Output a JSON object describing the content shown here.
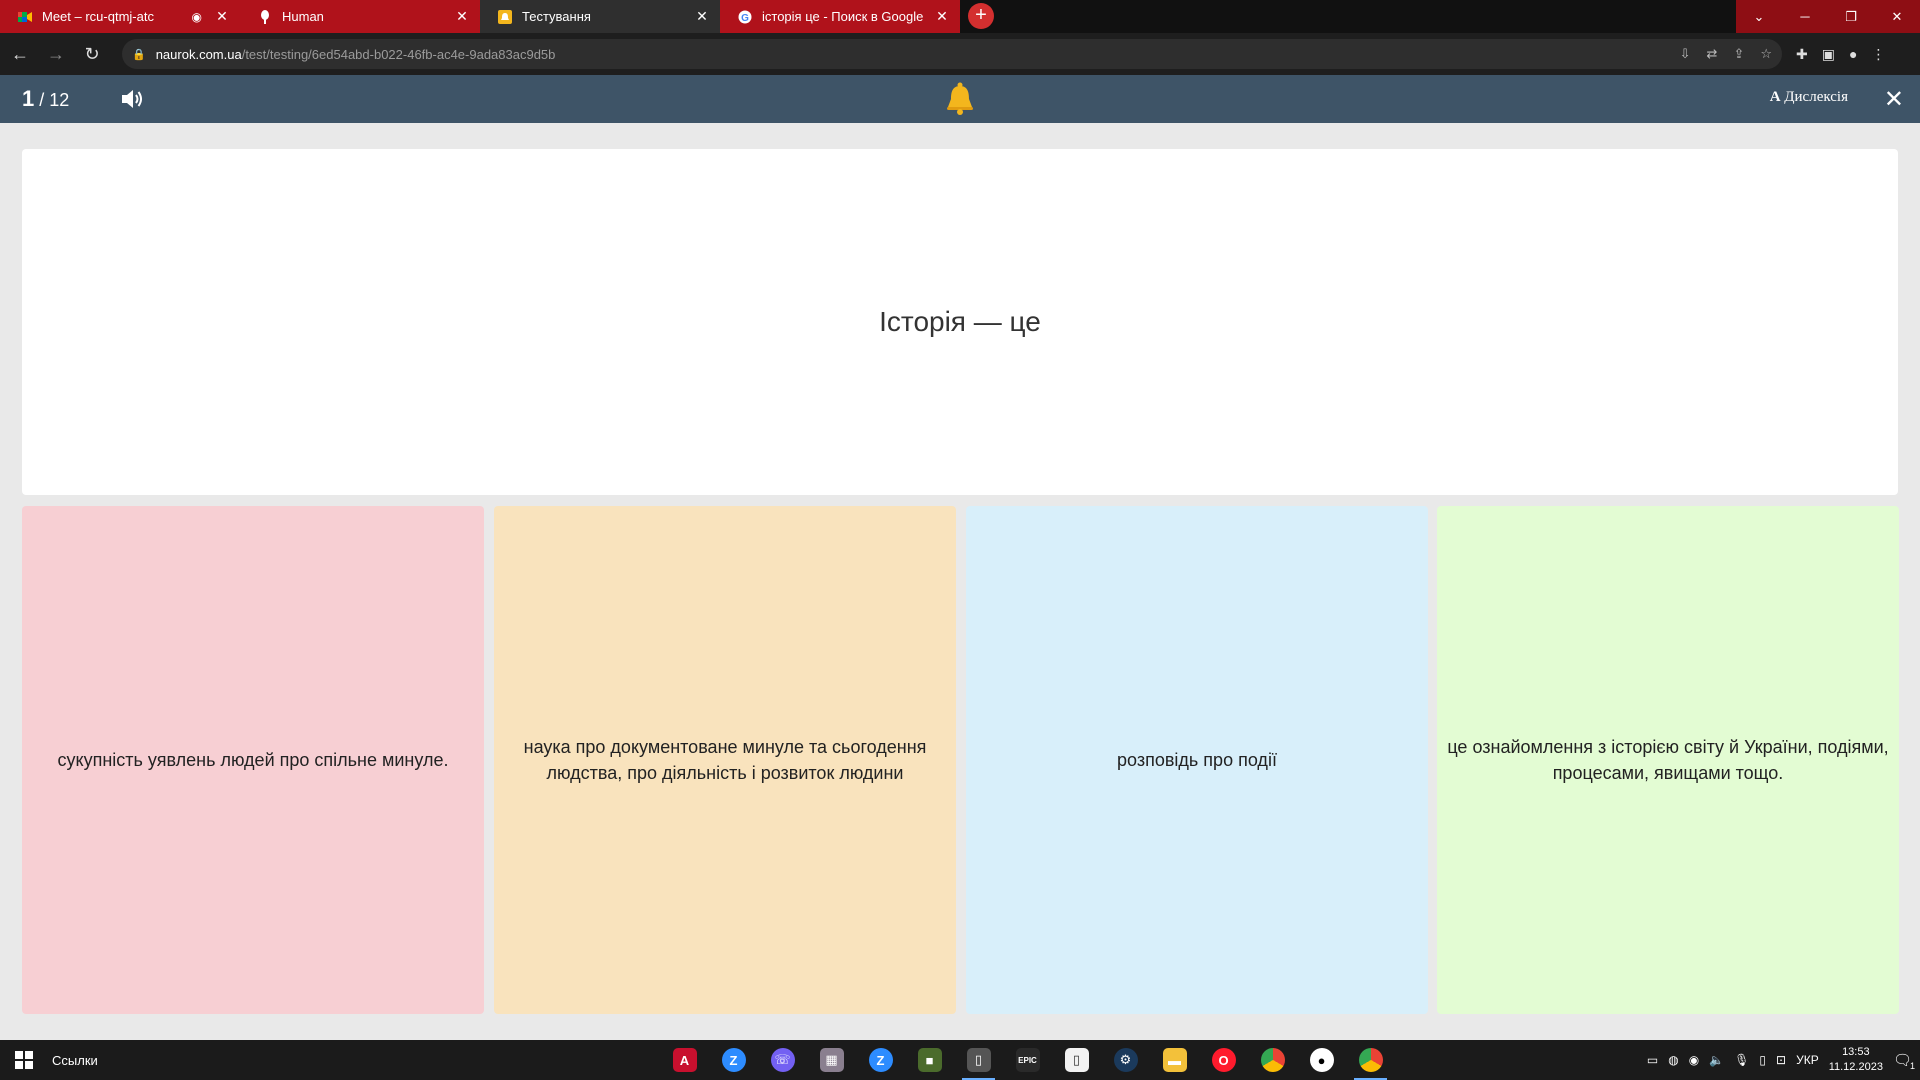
{
  "browser": {
    "tabs": [
      {
        "title": "Meet – rcu-qtmj-atc",
        "icon": "google-meet-icon",
        "recording": true
      },
      {
        "title": "Human",
        "icon": "human-icon"
      },
      {
        "title": "Тестування",
        "icon": "naurok-icon"
      },
      {
        "title": "історія це - Поиск в Google",
        "icon": "google-icon"
      }
    ],
    "url_host": "naurok.com.ua",
    "url_path": "/test/testing/6ed54abd-b022-46fb-ac4e-9ada83ac9d5b"
  },
  "quiz": {
    "current": "1",
    "total": "/ 12",
    "dyslexia_label": "Дислексія",
    "dyslexia_glyph": "A",
    "question": "Історія — це",
    "answers": [
      {
        "text": "сукупність уявлень людей про спільне минуле.",
        "color": "#f7cfd3"
      },
      {
        "text": "наука про документоване минуле та сьогодення людства, про діяльність і розвиток людини",
        "color": "#f9e3bd"
      },
      {
        "text": "розповідь про події",
        "color": "#d8effa"
      },
      {
        "text": "це ознайомлення з історією світу й України, подіями, процесами, явищами тощо.",
        "color": "#e3fcd3"
      }
    ]
  },
  "taskbar": {
    "links_label": "Ссылки",
    "language": "УКР",
    "time": "13:53",
    "date": "11.12.2023",
    "notification_count": "1",
    "apps": [
      "acrobat-icon",
      "zoom-z-icon",
      "viber-icon",
      "archive-icon",
      "zoom-icon",
      "minecraft-icon",
      "mouse-app-icon",
      "epic-games-icon",
      "file-icon",
      "steam-icon",
      "folder-icon",
      "opera-icon",
      "chrome-icon",
      "black-app-icon",
      "chrome-active-icon"
    ]
  },
  "colors": {
    "quiz_header": "#3e5467",
    "tab_red": "#b0121b",
    "bell": "#f3b61d"
  }
}
